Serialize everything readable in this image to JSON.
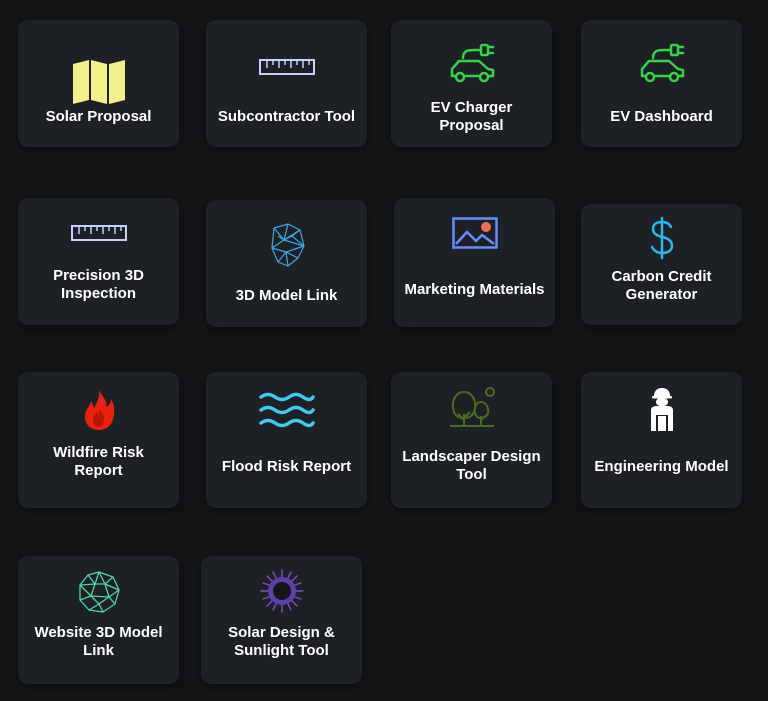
{
  "tiles": [
    {
      "id": "solar-proposal",
      "label": "Solar Proposal",
      "icon": "map-icon"
    },
    {
      "id": "subcontractor-tool",
      "label": "Subcontractor Tool",
      "icon": "ruler-icon"
    },
    {
      "id": "ev-charger-proposal",
      "label": "EV Charger Proposal",
      "icon": "electric-car-icon"
    },
    {
      "id": "ev-dashboard",
      "label": "EV Dashboard",
      "icon": "electric-car-icon"
    },
    {
      "id": "precision-3d-inspection",
      "label": "Precision 3D Inspection",
      "icon": "ruler-icon"
    },
    {
      "id": "3d-model-link",
      "label": "3D Model Link",
      "icon": "mesh-icon"
    },
    {
      "id": "marketing-materials",
      "label": "Marketing Materials",
      "icon": "image-icon"
    },
    {
      "id": "carbon-credit-generator",
      "label": "Carbon Credit Generator",
      "icon": "dollar-icon"
    },
    {
      "id": "wildfire-risk-report",
      "label": "Wildfire Risk Report",
      "icon": "fire-icon"
    },
    {
      "id": "flood-risk-report",
      "label": "Flood Risk Report",
      "icon": "waves-icon"
    },
    {
      "id": "landscaper-design-tool",
      "label": "Landscaper Design Tool",
      "icon": "trees-icon"
    },
    {
      "id": "engineering-model",
      "label": "Engineering Model",
      "icon": "engineer-icon"
    },
    {
      "id": "website-3d-model-link",
      "label": "Website 3D Model Link",
      "icon": "mesh-globe-icon"
    },
    {
      "id": "solar-design-sunlight-tool",
      "label": "Solar Design & Sunlight Tool",
      "icon": "eclipse-icon"
    }
  ],
  "colors": {
    "background": "#121416",
    "tile": "#1d2024",
    "map_icon": "#f3f08c",
    "ruler_icon": "#c8cfff",
    "ev_icon": "#39d04a",
    "mesh_icon": "#3ea7e6",
    "image_icon": "#6b8cff",
    "image_sun": "#f0705a",
    "dollar_icon": "#2bb7f0",
    "fire_icon": "#e8220e",
    "waves_icon": "#45c8f0",
    "trees_icon": "#4b6b22",
    "engineer_icon": "#ffffff",
    "mesh_globe_icon": "#4fd6a5",
    "eclipse_icon": "#7a52c8"
  }
}
